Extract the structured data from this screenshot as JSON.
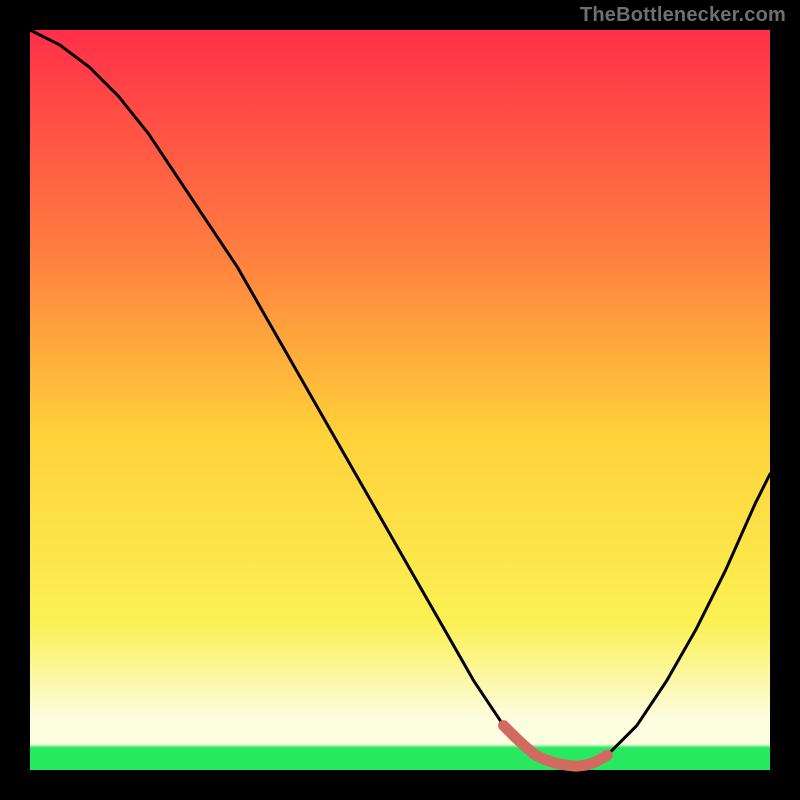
{
  "watermark": {
    "text": "TheBottlenecker.com"
  },
  "colors": {
    "frame": "#000000",
    "curve": "#000000",
    "marker": "#d16a61",
    "gradient_top": "#ff2f49",
    "gradient_mid1": "#ff7e3f",
    "gradient_mid2": "#ffd23a",
    "gradient_mid3": "#fbf153",
    "gradient_bottom_pale": "#fdfde0",
    "gradient_green": "#28e85f"
  },
  "chart_data": {
    "type": "line",
    "title": "",
    "xlabel": "",
    "ylabel": "",
    "xlim": [
      0,
      100
    ],
    "ylim": [
      0,
      100
    ],
    "grid": false,
    "legend": null,
    "series": [
      {
        "name": "bottleneck-curve",
        "x": [
          0,
          4,
          8,
          12,
          16,
          20,
          24,
          28,
          32,
          36,
          40,
          44,
          48,
          52,
          56,
          60,
          62,
          64,
          66,
          68,
          70,
          72,
          74,
          76,
          78,
          82,
          86,
          90,
          94,
          98,
          100
        ],
        "values": [
          100,
          98,
          95,
          91,
          86,
          80,
          74,
          68,
          61,
          54,
          47,
          40,
          33,
          26,
          19,
          12,
          9,
          6,
          4,
          2.2,
          1.2,
          0.7,
          0.5,
          0.8,
          2,
          6,
          12,
          19,
          27,
          36,
          40
        ]
      }
    ],
    "optimal_range": {
      "x_start": 64,
      "x_end": 78,
      "y": 1.0
    },
    "background_gradient": {
      "stops": [
        {
          "offset": 0.0,
          "color_key": "gradient_top"
        },
        {
          "offset": 0.3,
          "color_key": "gradient_mid1"
        },
        {
          "offset": 0.55,
          "color_key": "gradient_mid2"
        },
        {
          "offset": 0.8,
          "color_key": "gradient_mid3"
        },
        {
          "offset": 0.93,
          "color_key": "gradient_bottom_pale"
        },
        {
          "offset": 0.965,
          "color_key": "gradient_bottom_pale"
        },
        {
          "offset": 0.97,
          "color_key": "gradient_green"
        },
        {
          "offset": 1.0,
          "color_key": "gradient_green"
        }
      ]
    }
  }
}
